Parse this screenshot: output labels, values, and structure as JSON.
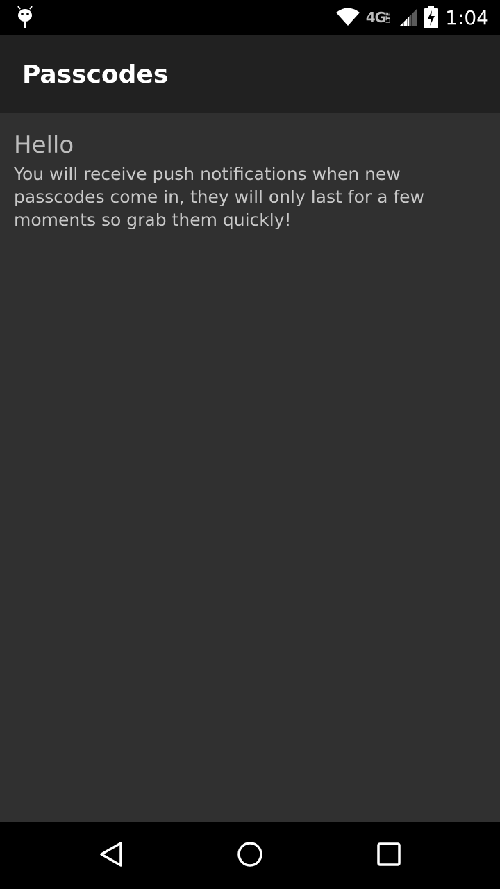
{
  "status_bar": {
    "left_icon": "android-debug-icon",
    "icons": [
      "wifi-icon",
      "network-4g-lte-icon",
      "signal-icon",
      "battery-charging-icon"
    ],
    "network_label": "4G",
    "network_sub": "LTE",
    "time": "1:04"
  },
  "app_bar": {
    "title": "Passcodes"
  },
  "main": {
    "greeting": "Hello",
    "message": "You will receive push notifications when new passcodes come in, they will only last for a few moments so grab them quickly!"
  },
  "nav_bar": {
    "buttons": [
      "back-icon",
      "home-icon",
      "recents-icon"
    ]
  },
  "colors": {
    "background": "#303030",
    "app_bar": "#212121",
    "status_bar": "#000000",
    "title_text": "#ffffff",
    "body_text": "#c8c8c8"
  }
}
